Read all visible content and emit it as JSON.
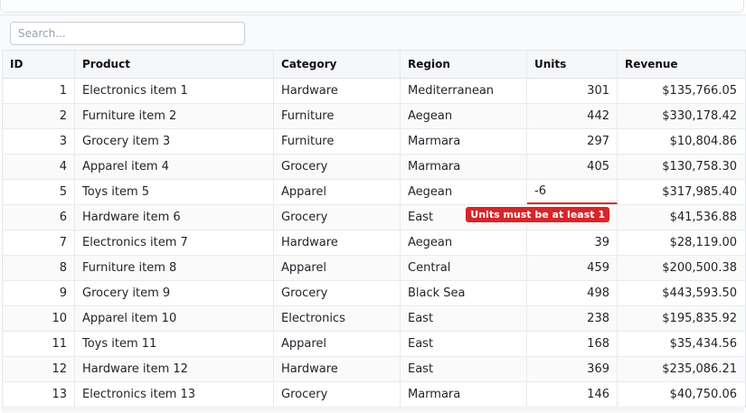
{
  "search": {
    "placeholder": "Search..."
  },
  "columns": {
    "id": "ID",
    "product": "Product",
    "category": "Category",
    "region": "Region",
    "units": "Units",
    "revenue": "Revenue"
  },
  "rows": [
    {
      "id": "1",
      "product": "Electronics item 1",
      "category": "Hardware",
      "region": "Mediterranean",
      "units": "301",
      "revenue": "$135,766.05"
    },
    {
      "id": "2",
      "product": "Furniture item 2",
      "category": "Furniture",
      "region": "Aegean",
      "units": "442",
      "revenue": "$330,178.42"
    },
    {
      "id": "3",
      "product": "Grocery item 3",
      "category": "Furniture",
      "region": "Marmara",
      "units": "297",
      "revenue": "$10,804.86"
    },
    {
      "id": "4",
      "product": "Apparel item 4",
      "category": "Grocery",
      "region": "Marmara",
      "units": "405",
      "revenue": "$130,758.30"
    },
    {
      "id": "5",
      "product": "Toys item 5",
      "category": "Apparel",
      "region": "Aegean",
      "units": "-6",
      "revenue": "$317,985.40"
    },
    {
      "id": "6",
      "product": "Hardware item 6",
      "category": "Grocery",
      "region": "East",
      "units": "",
      "revenue": "$41,536.88"
    },
    {
      "id": "7",
      "product": "Electronics item 7",
      "category": "Hardware",
      "region": "Aegean",
      "units": "39",
      "revenue": "$28,119.00"
    },
    {
      "id": "8",
      "product": "Furniture item 8",
      "category": "Apparel",
      "region": "Central",
      "units": "459",
      "revenue": "$200,500.38"
    },
    {
      "id": "9",
      "product": "Grocery item 9",
      "category": "Grocery",
      "region": "Black Sea",
      "units": "498",
      "revenue": "$443,593.50"
    },
    {
      "id": "10",
      "product": "Apparel item 10",
      "category": "Electronics",
      "region": "East",
      "units": "238",
      "revenue": "$195,835.92"
    },
    {
      "id": "11",
      "product": "Toys item 11",
      "category": "Apparel",
      "region": "East",
      "units": "168",
      "revenue": "$35,434.56"
    },
    {
      "id": "12",
      "product": "Hardware item 12",
      "category": "Hardware",
      "region": "East",
      "units": "369",
      "revenue": "$235,086.21"
    },
    {
      "id": "13",
      "product": "Electronics item 13",
      "category": "Grocery",
      "region": "Marmara",
      "units": "146",
      "revenue": "$40,750.06"
    }
  ],
  "editing": {
    "row_index": 4,
    "error": "Units must be at least 1"
  },
  "colors": {
    "error": "#d7262a",
    "header_bg": "#f6f7f9"
  }
}
